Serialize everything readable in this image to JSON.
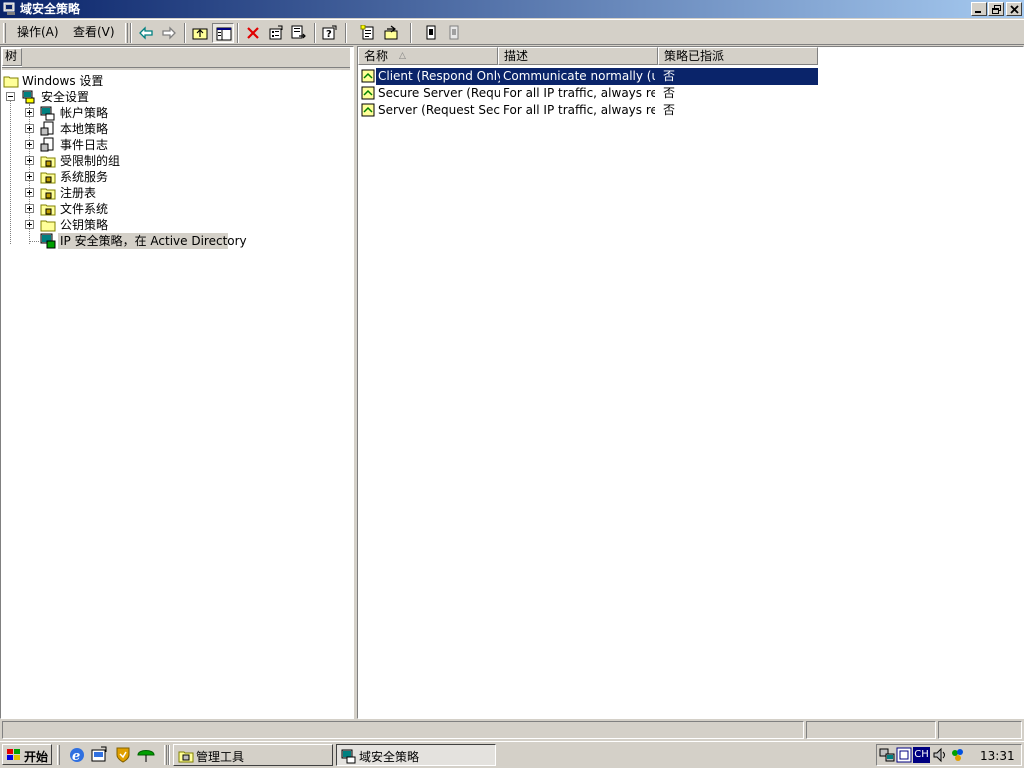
{
  "window": {
    "title": "域安全策略"
  },
  "menu": {
    "action": "操作(A)",
    "view": "查看(V)"
  },
  "toolbar": {
    "icons": [
      "back-arrow-icon",
      "forward-arrow-icon",
      "up-folder-icon",
      "show-hide-tree-icon",
      "delete-icon",
      "properties-icon",
      "export-list-icon",
      "help-icon",
      "create-policy-icon",
      "manage-filters-icon",
      "assign-icon",
      "unassign-icon"
    ]
  },
  "tree": {
    "tab_label": "树",
    "root": "Windows 设置",
    "security": "安全设置",
    "items": [
      {
        "label": "帐户策略"
      },
      {
        "label": "本地策略"
      },
      {
        "label": "事件日志"
      },
      {
        "label": "受限制的组"
      },
      {
        "label": "系统服务"
      },
      {
        "label": "注册表"
      },
      {
        "label": "文件系统"
      },
      {
        "label": "公钥策略"
      }
    ],
    "selected": "IP 安全策略，在 Active Directory"
  },
  "list": {
    "columns": [
      {
        "label": "名称"
      },
      {
        "label": "描述"
      },
      {
        "label": "策略已指派"
      }
    ],
    "sort_indicator": "△",
    "rows": [
      {
        "name": "Client (Respond Only)",
        "description": "Communicate normally (uns…",
        "assigned": "否",
        "selected": true
      },
      {
        "name": "Secure Server (Requir…",
        "description": "For all IP traffic, always req…",
        "assigned": "否",
        "selected": false
      },
      {
        "name": "Server (Request Secu…",
        "description": "For all IP traffic, always req…",
        "assigned": "否",
        "selected": false
      }
    ]
  },
  "taskbar": {
    "start": "开始",
    "tasks": [
      {
        "label": "管理工具",
        "active": false
      },
      {
        "label": "域安全策略",
        "active": true
      }
    ],
    "tray_lang": "CH",
    "clock": "13:31"
  },
  "colors": {
    "selection": "#0a246a",
    "title_gradient_start": "#0a246a",
    "title_gradient_end": "#a6caf0",
    "face": "#d4d0c8"
  }
}
